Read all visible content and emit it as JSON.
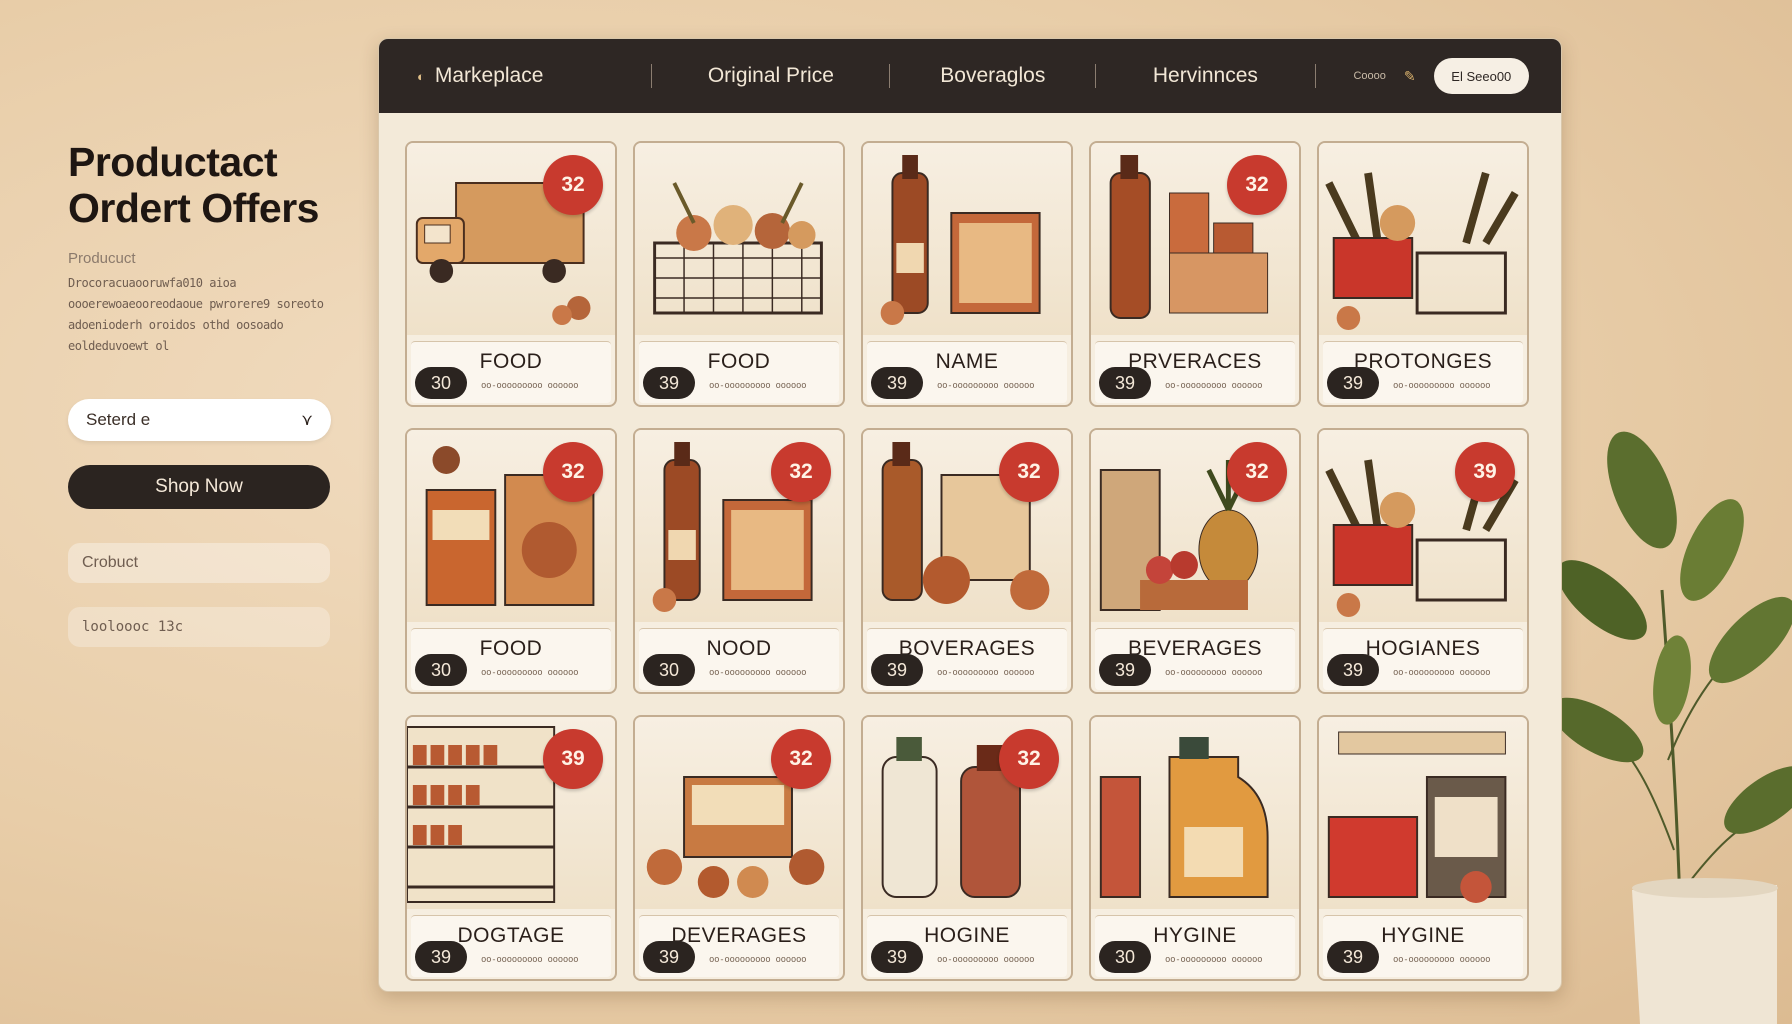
{
  "left": {
    "headline_line1": "Productact",
    "headline_line2": "Ordert Offers",
    "subhead": "Producuct",
    "blurb": "Drocoracuaooruwfa010 aioa oooerewoaeooreodaoue pwrorere9 soreoto adoenioderh oroidos othd oosoado eoldeduvoewt ol",
    "select_value": "Seterd e",
    "shop_button": "Shop Now",
    "field1": "Crobuct",
    "field2": "looloooc 13c"
  },
  "navbar": {
    "brand": "Markeplace",
    "tab1": "Original Price",
    "tab2": "Boveraglos",
    "tab3": "Hervinnces",
    "small": "Coooo",
    "search": "El Seeo00"
  },
  "cards": [
    {
      "title": "FOOD",
      "badge": "32",
      "price": "30",
      "meta": "oo-ooooooooo oooooo",
      "art": "truck"
    },
    {
      "title": "FOOD",
      "badge": "",
      "price": "39",
      "meta": "oo-ooooooooo oooooo",
      "art": "basket"
    },
    {
      "title": "NAME",
      "badge": "",
      "price": "39",
      "meta": "oo-ooooooooo oooooo",
      "art": "bottle-box"
    },
    {
      "title": "PRVERACES",
      "badge": "32",
      "price": "39",
      "meta": "oo-ooooooooo oooooo",
      "art": "bottle-cans"
    },
    {
      "title": "PROTONGES",
      "badge": "",
      "price": "39",
      "meta": "oo-ooooooooo oooooo",
      "art": "crate"
    },
    {
      "title": "FOOD",
      "badge": "32",
      "price": "30",
      "meta": "oo-ooooooooo oooooo",
      "art": "boxes"
    },
    {
      "title": "NOOD",
      "badge": "32",
      "price": "30",
      "meta": "oo-ooooooooo oooooo",
      "art": "bottle-box"
    },
    {
      "title": "BOVERAGES",
      "badge": "32",
      "price": "39",
      "meta": "oo-ooooooooo oooooo",
      "art": "bottle-fruit"
    },
    {
      "title": "BEVERAGES",
      "badge": "32",
      "price": "39",
      "meta": "oo-ooooooooo oooooo",
      "art": "pineapple"
    },
    {
      "title": "HOGIANES",
      "badge": "39",
      "price": "39",
      "meta": "oo-ooooooooo oooooo",
      "art": "crate"
    },
    {
      "title": "DOGTAGE",
      "badge": "39",
      "price": "39",
      "meta": "oo-ooooooooo oooooo",
      "art": "shelves"
    },
    {
      "title": "DEVERAGES",
      "badge": "32",
      "price": "39",
      "meta": "oo-ooooooooo oooooo",
      "art": "box-fruit"
    },
    {
      "title": "HOGINE",
      "badge": "32",
      "price": "39",
      "meta": "oo-ooooooooo oooooo",
      "art": "milk"
    },
    {
      "title": "HYGINE",
      "badge": "",
      "price": "30",
      "meta": "oo-ooooooooo oooooo",
      "art": "jug"
    },
    {
      "title": "HYGINE",
      "badge": "",
      "price": "39",
      "meta": "oo-ooooooooo oooooo",
      "art": "cola"
    }
  ],
  "colors": {
    "accent_red": "#c83a2e",
    "dark": "#2b2420",
    "cream": "#f3ead9",
    "background": "#e8cda8"
  }
}
